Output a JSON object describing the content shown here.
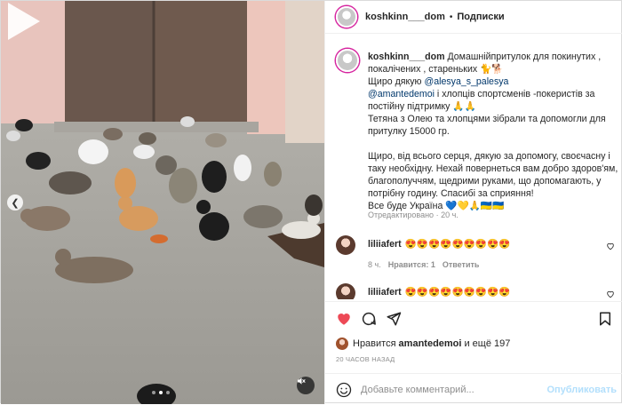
{
  "post": {
    "username": "koshkinn___dom",
    "follow_label": "Подписки",
    "separator": "•",
    "caption_lines": [
      "Домашнійпритулок для покинутих , покалічених , стареньких 🐈🐕",
      "Щиро дякую",
      "і хлопців спортсменів -покеристів за постійну підтримку 🙏🙏",
      "Тетяна з Олею та хлопцями зібрали та допомогли для притулку 15000 гр.",
      "Щиро, від всього серця, дякую за допомогу, своєчасну і таку необхідну. Нехай повернеться вам добро здоров'ям, благополуччям, щедрими руками, що допомагають, у потрібну годину. Спасибі за сприяння!",
      "Все буде Україна 💙💛🙏🇺🇦🇺🇦"
    ],
    "mention1": "@alesya_s_palesya",
    "mention2": "@amantedemoi",
    "edited": "Отредактировано",
    "edited_time": "20 ч."
  },
  "comments": [
    {
      "username": "liliiafert",
      "text": "😍😍😍😍😍😍😍😍😍",
      "time": "8 ч.",
      "likes": "Нравится: 1",
      "reply": "Ответить"
    },
    {
      "username": "liliiafert",
      "text": "😍😍😍😍😍😍😍😍😍"
    }
  ],
  "likes": {
    "prefix": "Нравится",
    "user": "amantedemoi",
    "suffix": "и ещё 197"
  },
  "timestamp": "20 ЧАСОВ НАЗАД",
  "comment_box": {
    "placeholder": "Добавьте комментарий...",
    "post_label": "Опубликовать"
  },
  "colors": {
    "accent_link": "#00376b",
    "like_red": "#ed4956",
    "post_disabled": "#b2dffc",
    "muted": "#8e8e8e"
  },
  "media": {
    "carousel_count": 3,
    "active_index": 1
  }
}
